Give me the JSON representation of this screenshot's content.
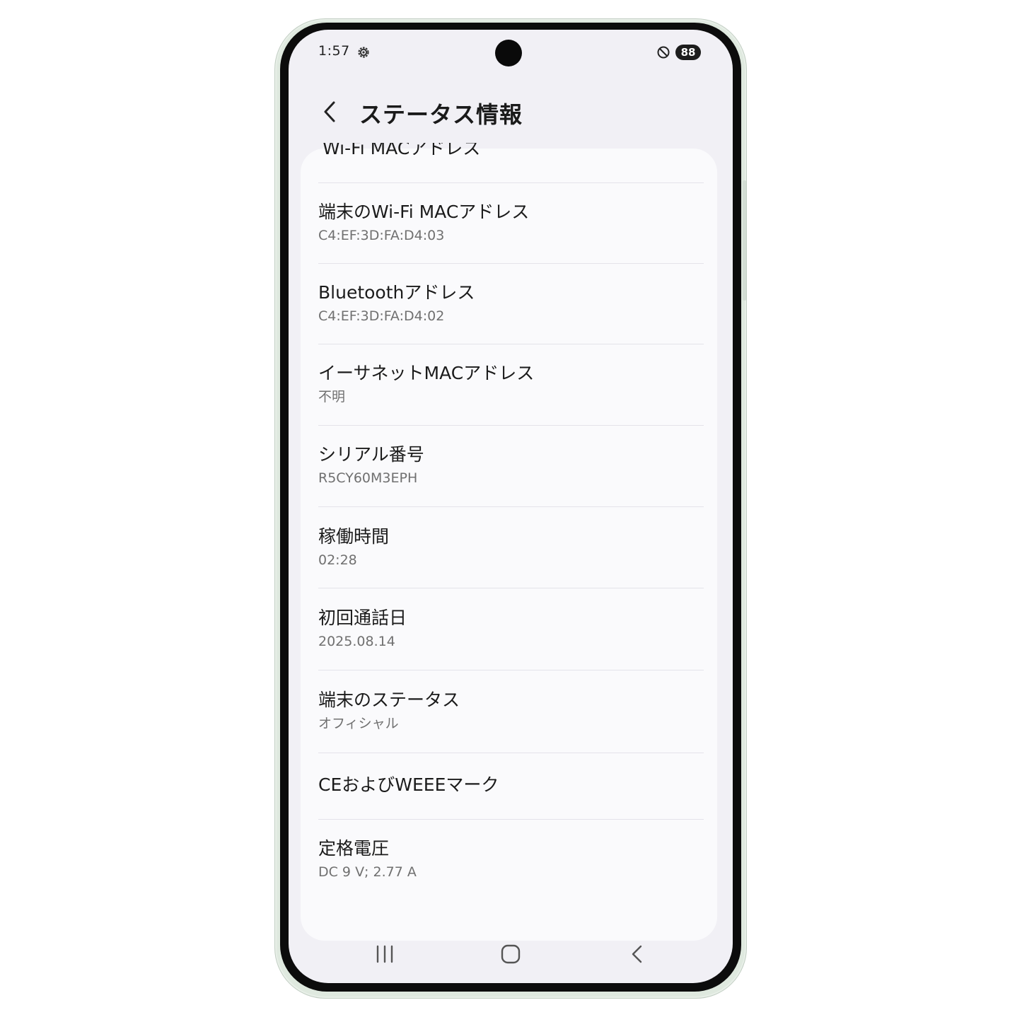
{
  "status_bar": {
    "time": "1:57",
    "icons": [
      "gear-icon",
      "do-not-disturb-icon"
    ],
    "battery": "88"
  },
  "header": {
    "title": "ステータス情報",
    "back_icon": "chevron-left-icon"
  },
  "list": {
    "clipped_item_label": "Wi-Fi MACアドレス",
    "items": [
      {
        "label": "端末のWi-Fi MACアドレス",
        "value": "C4:EF:3D:FA:D4:03"
      },
      {
        "label": "Bluetoothアドレス",
        "value": "C4:EF:3D:FA:D4:02"
      },
      {
        "label": "イーサネットMACアドレス",
        "value": "不明"
      },
      {
        "label": "シリアル番号",
        "value": "R5CY60M3EPH"
      },
      {
        "label": "稼働時間",
        "value": "02:28"
      },
      {
        "label": "初回通話日",
        "value": "2025.08.14"
      },
      {
        "label": "端末のステータス",
        "value": "オフィシャル"
      },
      {
        "label": "CEおよびWEEEマーク",
        "value": ""
      },
      {
        "label": "定格電圧",
        "value": "DC 9 V; 2.77 A"
      }
    ]
  },
  "nav_bar": {
    "recents_icon": "recents-icon",
    "home_icon": "home-icon",
    "back_icon": "back-icon"
  },
  "colors": {
    "screen_bg": "#f1f0f5",
    "card_bg": "#fafafc",
    "text_primary": "#1b1b1b",
    "text_secondary": "#707070",
    "frame": "#dfe9df"
  }
}
